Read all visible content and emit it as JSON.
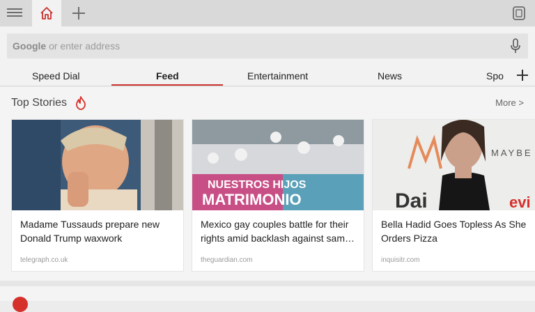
{
  "browser": {
    "address_bar": {
      "brand": "Google",
      "placeholder": " or enter address"
    }
  },
  "nav_tabs": [
    {
      "label": "Speed Dial"
    },
    {
      "label": "Feed",
      "active": true
    },
    {
      "label": "Entertainment"
    },
    {
      "label": "News"
    },
    {
      "label": "Spo"
    }
  ],
  "section": {
    "title": "Top Stories",
    "more_label": "More",
    "more_chevron": ">"
  },
  "stories": [
    {
      "headline": "Madame Tussauds prepare new Donald Trump waxwork",
      "source": "telegraph.co.uk"
    },
    {
      "headline": "Mexico gay couples battle for their rights amid backlash against sam…",
      "source": "theguardian.com"
    },
    {
      "headline": "Bella Hadid Goes Topless As She Orders Pizza",
      "source": "inquisitr.com"
    }
  ],
  "image_text": {
    "banner_line1": "NUESTROS HIJOS",
    "banner_line2": "MATRIMONIO",
    "ad_brand": "MAYBE",
    "ad_logo": "Dai",
    "ad_corner": "evi"
  },
  "colors": {
    "accent": "#c9302c",
    "topbar": "#d9d9d9",
    "page_bg": "#f4f4f4"
  },
  "icons": [
    "menu-icon",
    "home-icon",
    "plus-icon",
    "tabs-icon",
    "microphone-icon",
    "flame-icon",
    "chevron-right-icon"
  ]
}
